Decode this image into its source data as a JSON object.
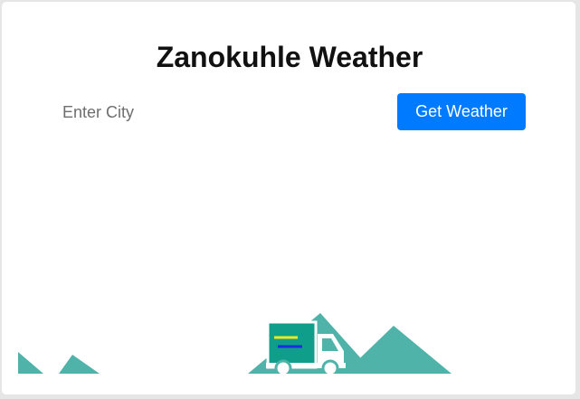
{
  "header": {
    "title": "Zanokuhle Weather"
  },
  "search": {
    "placeholder": "Enter City",
    "value": "",
    "button_label": "Get Weather"
  },
  "colors": {
    "accent": "#007bff",
    "mountain": "#4fb3a9",
    "truck_cargo": "#0f9e8a",
    "truck_white": "#ffffff",
    "stripe_yellow": "#e8e823",
    "stripe_blue": "#1a2ee0"
  },
  "illustration": {
    "icon": "delivery-truck-icon"
  }
}
